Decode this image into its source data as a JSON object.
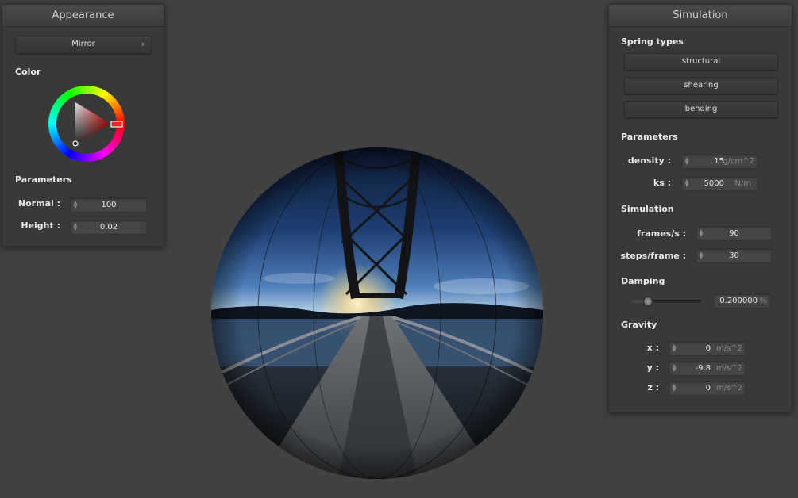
{
  "appearance": {
    "title": "Appearance",
    "material_label": "Mirror",
    "color_label": "Color",
    "parameters_label": "Parameters",
    "normal_label": "Normal :",
    "normal_value": "100",
    "height_label": "Height :",
    "height_value": "0.02"
  },
  "simulation": {
    "title": "Simulation",
    "spring_types_label": "Spring types",
    "spring_buttons": [
      "structural",
      "shearing",
      "bending"
    ],
    "parameters_label": "Parameters",
    "density_label": "density :",
    "density_value": "15",
    "density_unit": "g/cm^2",
    "ks_label": "ks :",
    "ks_value": "5000",
    "ks_unit": "N/m",
    "simulation_label": "Simulation",
    "fps_label": "frames/s :",
    "fps_value": "90",
    "steps_label": "steps/frame :",
    "steps_value": "30",
    "damping_label": "Damping",
    "damping_value": "0.200000",
    "damping_unit": "%",
    "damping_fraction": 0.2,
    "gravity_label": "Gravity",
    "gx_label": "x :",
    "gx_value": "0",
    "gy_label": "y :",
    "gy_value": "-9.8",
    "gz_label": "z :",
    "gz_value": "0",
    "gravity_unit": "m/s^2"
  },
  "colors": {
    "background": "#424242",
    "panel": "#393939"
  },
  "icons": [
    "spin-arrows-icon",
    "chevron-right-icon",
    "color-wheel"
  ]
}
